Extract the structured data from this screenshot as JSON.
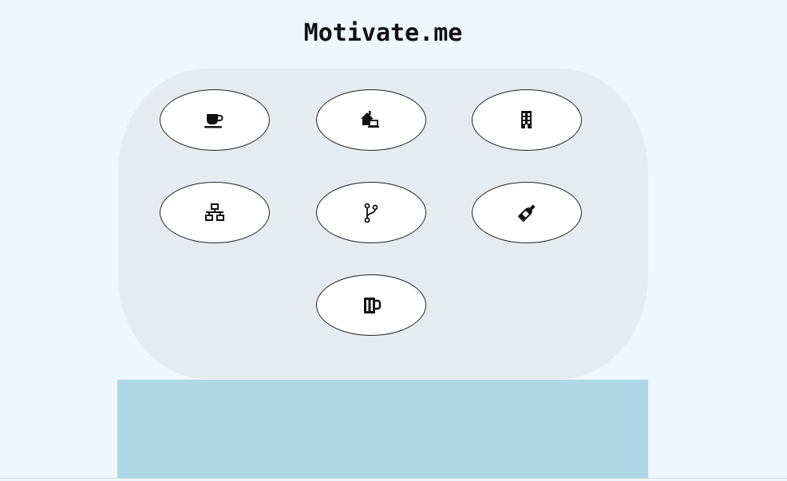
{
  "app": {
    "title": "Motivate.me"
  },
  "buttons": [
    {
      "id": "coffee",
      "icon": "coffee-cup-icon"
    },
    {
      "id": "work-from-home",
      "icon": "house-laptop-icon"
    },
    {
      "id": "office",
      "icon": "office-building-icon"
    },
    {
      "id": "network",
      "icon": "network-tree-icon"
    },
    {
      "id": "branch",
      "icon": "code-branch-icon"
    },
    {
      "id": "bottle",
      "icon": "bottle-icon"
    },
    {
      "id": "beer",
      "icon": "beer-mug-icon"
    }
  ],
  "colors": {
    "background": "#eef6fe",
    "panel": "#e6ebf0",
    "button_fill": "#ffffff",
    "content_area": "#add8e6"
  }
}
